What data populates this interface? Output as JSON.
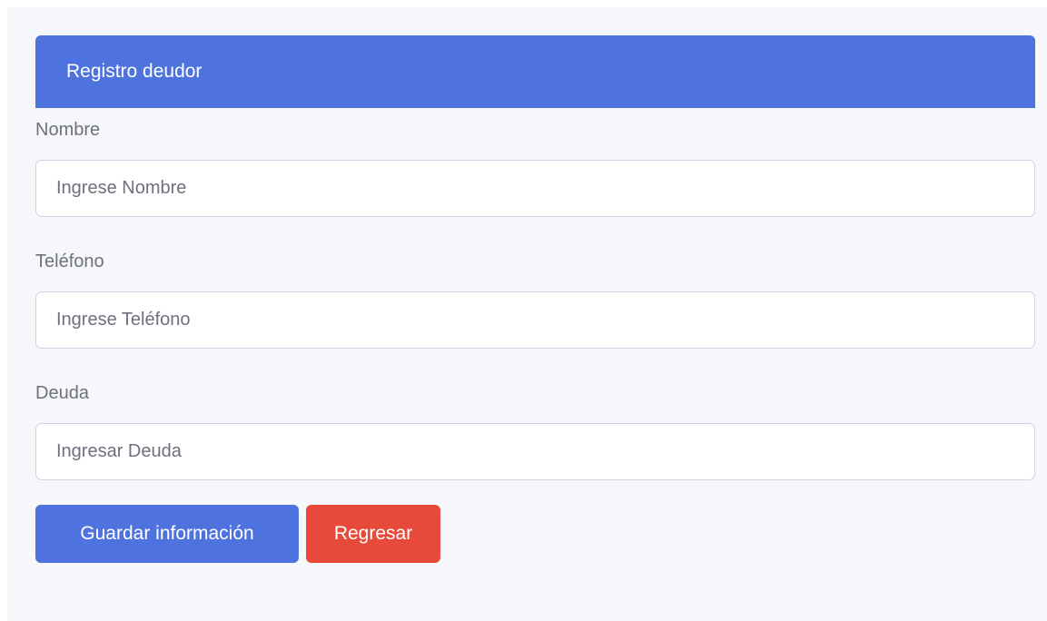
{
  "card": {
    "title": "Registro deudor"
  },
  "form": {
    "fields": [
      {
        "label": "Nombre",
        "placeholder": "Ingrese Nombre",
        "value": ""
      },
      {
        "label": "Teléfono",
        "placeholder": "Ingrese Teléfono",
        "value": ""
      },
      {
        "label": "Deuda",
        "placeholder": "Ingresar Deuda",
        "value": ""
      }
    ],
    "buttons": {
      "save_label": "Guardar información",
      "back_label": "Regresar"
    }
  },
  "colors": {
    "primary": "#4e73df",
    "danger": "#e74a3b",
    "background": "#f6f7fb",
    "text_muted": "#6e707e"
  }
}
